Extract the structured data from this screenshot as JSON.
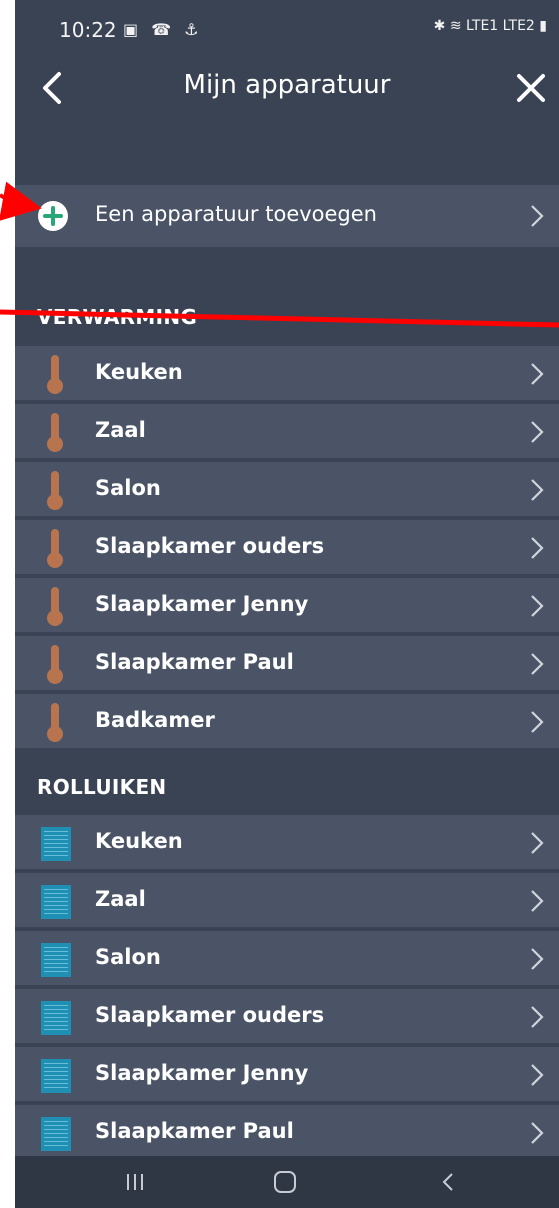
{
  "status_bar": {
    "time": "10:22",
    "left_icons": "▣ ☎ ⚓",
    "right_icons": "✱ ≋ LTE1 LTE2 ▮"
  },
  "header": {
    "title": "Mijn apparatuur"
  },
  "add_device": {
    "label": "Een apparatuur toevoegen"
  },
  "sections": {
    "heating": {
      "title": "VERWARMING",
      "items": [
        "Keuken",
        "Zaal",
        "Salon",
        "Slaapkamer ouders",
        "Slaapkamer Jenny",
        "Slaapkamer Paul",
        "Badkamer"
      ]
    },
    "shutters": {
      "title": "ROLLUIKEN",
      "items": [
        "Keuken",
        "Zaal",
        "Salon",
        "Slaapkamer ouders",
        "Slaapkamer Jenny",
        "Slaapkamer Paul"
      ]
    }
  },
  "colors": {
    "background": "#3a4354",
    "row": "#4a5466",
    "thermostat": "#b8744f",
    "shutter": "#1f8fb3",
    "add_plus": "#2aa57a",
    "annotation": "#ff0000"
  },
  "icons": {
    "thermostat": "thermometer-icon",
    "shutter": "shutter-icon",
    "add": "plus-circle-icon",
    "back": "chevron-left-icon",
    "close": "close-icon",
    "row": "chevron-right-icon"
  }
}
